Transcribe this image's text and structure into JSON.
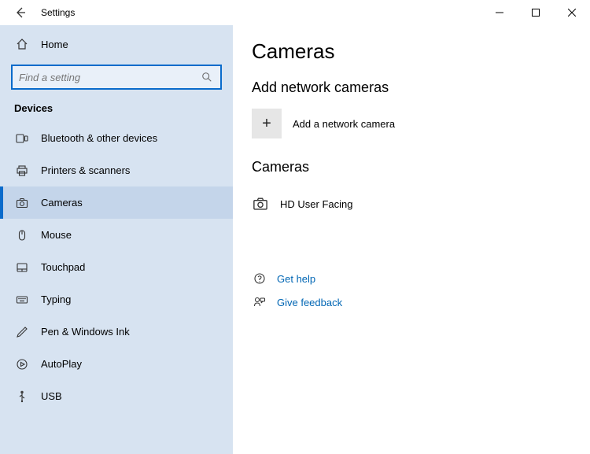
{
  "titlebar": {
    "title": "Settings"
  },
  "sidebar": {
    "home_label": "Home",
    "search_placeholder": "Find a setting",
    "group_title": "Devices",
    "items": [
      {
        "label": "Bluetooth & other devices"
      },
      {
        "label": "Printers & scanners"
      },
      {
        "label": "Cameras"
      },
      {
        "label": "Mouse"
      },
      {
        "label": "Touchpad"
      },
      {
        "label": "Typing"
      },
      {
        "label": "Pen & Windows Ink"
      },
      {
        "label": "AutoPlay"
      },
      {
        "label": "USB"
      }
    ]
  },
  "main": {
    "page_title": "Cameras",
    "add_section_title": "Add network cameras",
    "add_label": "Add a network camera",
    "cameras_section_title": "Cameras",
    "devices": [
      {
        "label": "HD User Facing"
      }
    ],
    "help": {
      "get_help": "Get help",
      "give_feedback": "Give feedback"
    }
  }
}
